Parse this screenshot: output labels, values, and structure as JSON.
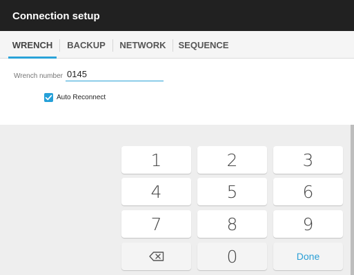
{
  "app": {
    "title": "Connection setup"
  },
  "tabs": [
    {
      "label": "WRENCH",
      "active": true
    },
    {
      "label": "BACKUP",
      "active": false
    },
    {
      "label": "NETWORK",
      "active": false
    },
    {
      "label": "SEQUENCE",
      "active": false
    }
  ],
  "form": {
    "wrench_number_label": "Wrench number",
    "wrench_number_value": "0145",
    "auto_reconnect_label": "Auto Reconnect",
    "auto_reconnect_checked": true
  },
  "keypad": {
    "keys": [
      "1",
      "2",
      "3",
      "4",
      "5",
      "6",
      "7",
      "8",
      "9",
      "0"
    ],
    "backspace_icon": "backspace-icon",
    "done_label": "Done"
  },
  "colors": {
    "accent": "#2aa3d8",
    "titlebar": "#212121",
    "keyboard_bg": "#eeeeee"
  }
}
